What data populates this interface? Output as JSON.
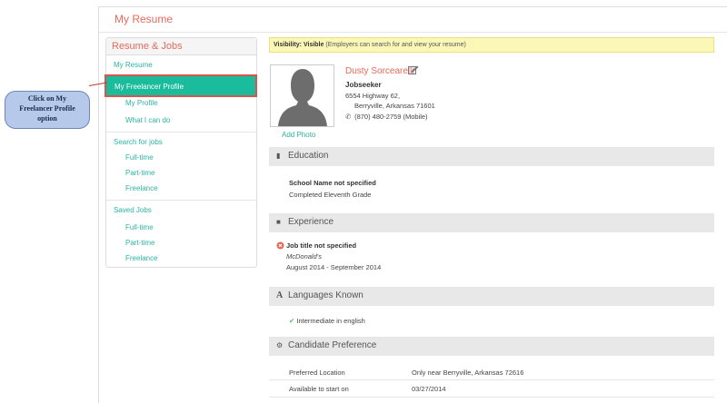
{
  "page": {
    "title": "My Resume"
  },
  "sidebar": {
    "heading": "Resume & Jobs",
    "items": [
      {
        "label": "My Resume"
      },
      {
        "label": "My Freelancer Profile"
      },
      {
        "label": "My Profile"
      },
      {
        "label": "What I can do"
      },
      {
        "label": "Search for jobs"
      },
      {
        "label": "Full-time"
      },
      {
        "label": "Part-time"
      },
      {
        "label": "Freelance"
      },
      {
        "label": "Saved Jobs"
      },
      {
        "label": "Full-time"
      },
      {
        "label": "Part-time"
      },
      {
        "label": "Freelance"
      }
    ]
  },
  "callout": {
    "line1": "Click on My",
    "line2": "Freelancer Profile",
    "line3": "option"
  },
  "visibility": {
    "label": "Visibility:",
    "value": "Visible",
    "note": "(Employers can search for and view your resume)"
  },
  "profile": {
    "name": "Dusty Sorcearelli",
    "role": "Jobseeker",
    "address_line1": "6554 Highway 62,",
    "address_line2": "Berryville, Arkansas  71601",
    "phone": "(870) 480-2759 (Mobile)",
    "add_photo": "Add Photo"
  },
  "education": {
    "heading": "Education",
    "school": "School Name not specified",
    "grade": "Completed Eleventh Grade"
  },
  "experience": {
    "heading": "Experience",
    "title": "Job title not specified",
    "company": "McDonald's",
    "dates": "August 2014 - September 2014"
  },
  "languages": {
    "heading": "Languages Known",
    "item": "Intermediate in english"
  },
  "preference": {
    "heading": "Candidate Preference",
    "rows": [
      {
        "label": "Preferred Location",
        "value": "Only near Berryville, Arkansas 72616"
      },
      {
        "label": "Available to start on",
        "value": "03/27/2014"
      }
    ]
  },
  "colors": {
    "accent": "#e8695a",
    "teal": "#1abc9c",
    "link": "#2ab5a0",
    "callout": "#b7c9ea",
    "highlight_border": "#d9534f"
  }
}
